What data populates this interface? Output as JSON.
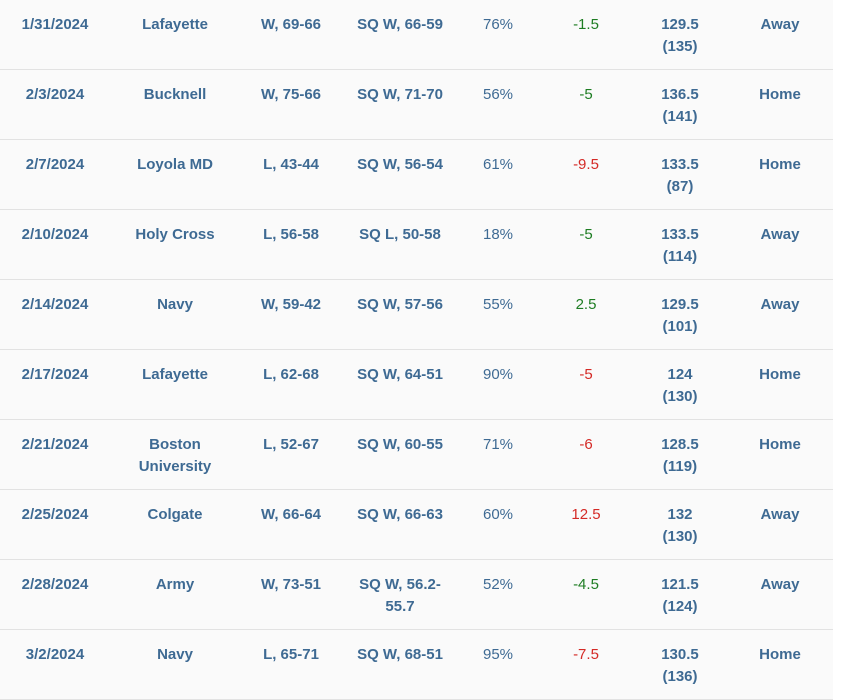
{
  "rows": [
    {
      "date": "1/31/2024",
      "opponent": "Lafayette",
      "result": "W, 69-66",
      "sq": "SQ W, 66-59",
      "pct": "76%",
      "spread": "-1.5",
      "spread_color": "#1e7d23",
      "total": "129.5",
      "total_sub": "(135)",
      "location": "Away"
    },
    {
      "date": "2/3/2024",
      "opponent": "Bucknell",
      "result": "W, 75-66",
      "sq": "SQ W, 71-70",
      "pct": "56%",
      "spread": "-5",
      "spread_color": "#1e7d23",
      "total": "136.5",
      "total_sub": "(141)",
      "location": "Home"
    },
    {
      "date": "2/7/2024",
      "opponent": "Loyola MD",
      "result": "L, 43-44",
      "sq": "SQ W, 56-54",
      "pct": "61%",
      "spread": "-9.5",
      "spread_color": "#d42a26",
      "total": "133.5",
      "total_sub": "(87)",
      "location": "Home"
    },
    {
      "date": "2/10/2024",
      "opponent": "Holy Cross",
      "result": "L, 56-58",
      "sq": "SQ L, 50-58",
      "pct": "18%",
      "spread": "-5",
      "spread_color": "#1e7d23",
      "total": "133.5",
      "total_sub": "(114)",
      "location": "Away"
    },
    {
      "date": "2/14/2024",
      "opponent": "Navy",
      "result": "W, 59-42",
      "sq": "SQ W, 57-56",
      "pct": "55%",
      "spread": "2.5",
      "spread_color": "#1e7d23",
      "total": "129.5",
      "total_sub": "(101)",
      "location": "Away"
    },
    {
      "date": "2/17/2024",
      "opponent": "Lafayette",
      "result": "L, 62-68",
      "sq": "SQ W, 64-51",
      "pct": "90%",
      "spread": "-5",
      "spread_color": "#d42a26",
      "total": "124",
      "total_sub": "(130)",
      "location": "Home"
    },
    {
      "date": "2/21/2024",
      "opponent": "Boston University",
      "result": "L, 52-67",
      "sq": "SQ W, 60-55",
      "pct": "71%",
      "spread": "-6",
      "spread_color": "#d42a26",
      "total": "128.5",
      "total_sub": "(119)",
      "location": "Home"
    },
    {
      "date": "2/25/2024",
      "opponent": "Colgate",
      "result": "W, 66-64",
      "sq": "SQ W, 66-63",
      "pct": "60%",
      "spread": "12.5",
      "spread_color": "#d42a26",
      "total": "132",
      "total_sub": "(130)",
      "location": "Away"
    },
    {
      "date": "2/28/2024",
      "opponent": "Army",
      "result": "W, 73-51",
      "sq": "SQ W, 56.2-55.7",
      "pct": "52%",
      "spread": "-4.5",
      "spread_color": "#1e7d23",
      "total": "121.5",
      "total_sub": "(124)",
      "location": "Away"
    },
    {
      "date": "3/2/2024",
      "opponent": "Navy",
      "result": "L, 65-71",
      "sq": "SQ W, 68-51",
      "pct": "95%",
      "spread": "-7.5",
      "spread_color": "#d42a26",
      "total": "130.5",
      "total_sub": "(136)",
      "location": "Home"
    }
  ]
}
